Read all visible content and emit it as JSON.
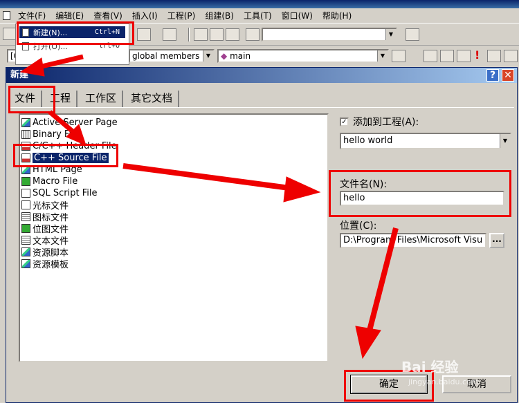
{
  "menubar": {
    "items": [
      "文件(F)",
      "编辑(E)",
      "查看(V)",
      "插入(I)",
      "工程(P)",
      "组建(B)",
      "工具(T)",
      "窗口(W)",
      "帮助(H)"
    ]
  },
  "file_menu": {
    "new_label": "新建(N)...",
    "new_shortcut": "Ctrl+N",
    "open_label": "打开(O)...",
    "open_shortcut": "trl+O"
  },
  "toolbar": {
    "scope_combo": "global members",
    "function_combo": "main",
    "left_combo": "[G"
  },
  "dialog": {
    "title": "新建",
    "help_label": "?",
    "close_label": "✕",
    "tabs": [
      "文件",
      "工程",
      "工作区",
      "其它文档"
    ],
    "file_types": [
      {
        "label": "Active Server Page",
        "icon": "asp-icon"
      },
      {
        "label": "Binary File",
        "icon": "binary-file-icon"
      },
      {
        "label": "C/C++ Header File",
        "icon": "header-file-icon"
      },
      {
        "label": "C++ Source File",
        "icon": "cpp-source-icon",
        "selected": true
      },
      {
        "label": "HTML Page",
        "icon": "html-page-icon"
      },
      {
        "label": "Macro File",
        "icon": "macro-file-icon"
      },
      {
        "label": "SQL Script File",
        "icon": "sql-script-icon"
      },
      {
        "label": "光标文件",
        "icon": "cursor-file-icon"
      },
      {
        "label": "图标文件",
        "icon": "icon-file-icon"
      },
      {
        "label": "位图文件",
        "icon": "bitmap-file-icon"
      },
      {
        "label": "文本文件",
        "icon": "text-file-icon"
      },
      {
        "label": "资源脚本",
        "icon": "resource-script-icon"
      },
      {
        "label": "资源模板",
        "icon": "resource-template-icon"
      }
    ],
    "add_to_project_label": "添加到工程(A):",
    "add_to_project_checked": true,
    "project_value": "hello world",
    "filename_label": "文件名(N):",
    "filename_value": "hello",
    "location_label": "位置(C):",
    "location_value": "D:\\Program Files\\Microsoft Visu",
    "browse_label": "...",
    "ok_label": "确定",
    "cancel_label": "取消"
  },
  "watermark": {
    "brand": "Bai 经验",
    "url": "jingyan.baidu.com"
  },
  "colors": {
    "annotation_red": "#e00000",
    "selection_blue": "#0a246a",
    "dialog_bg": "#d4d0c8"
  }
}
